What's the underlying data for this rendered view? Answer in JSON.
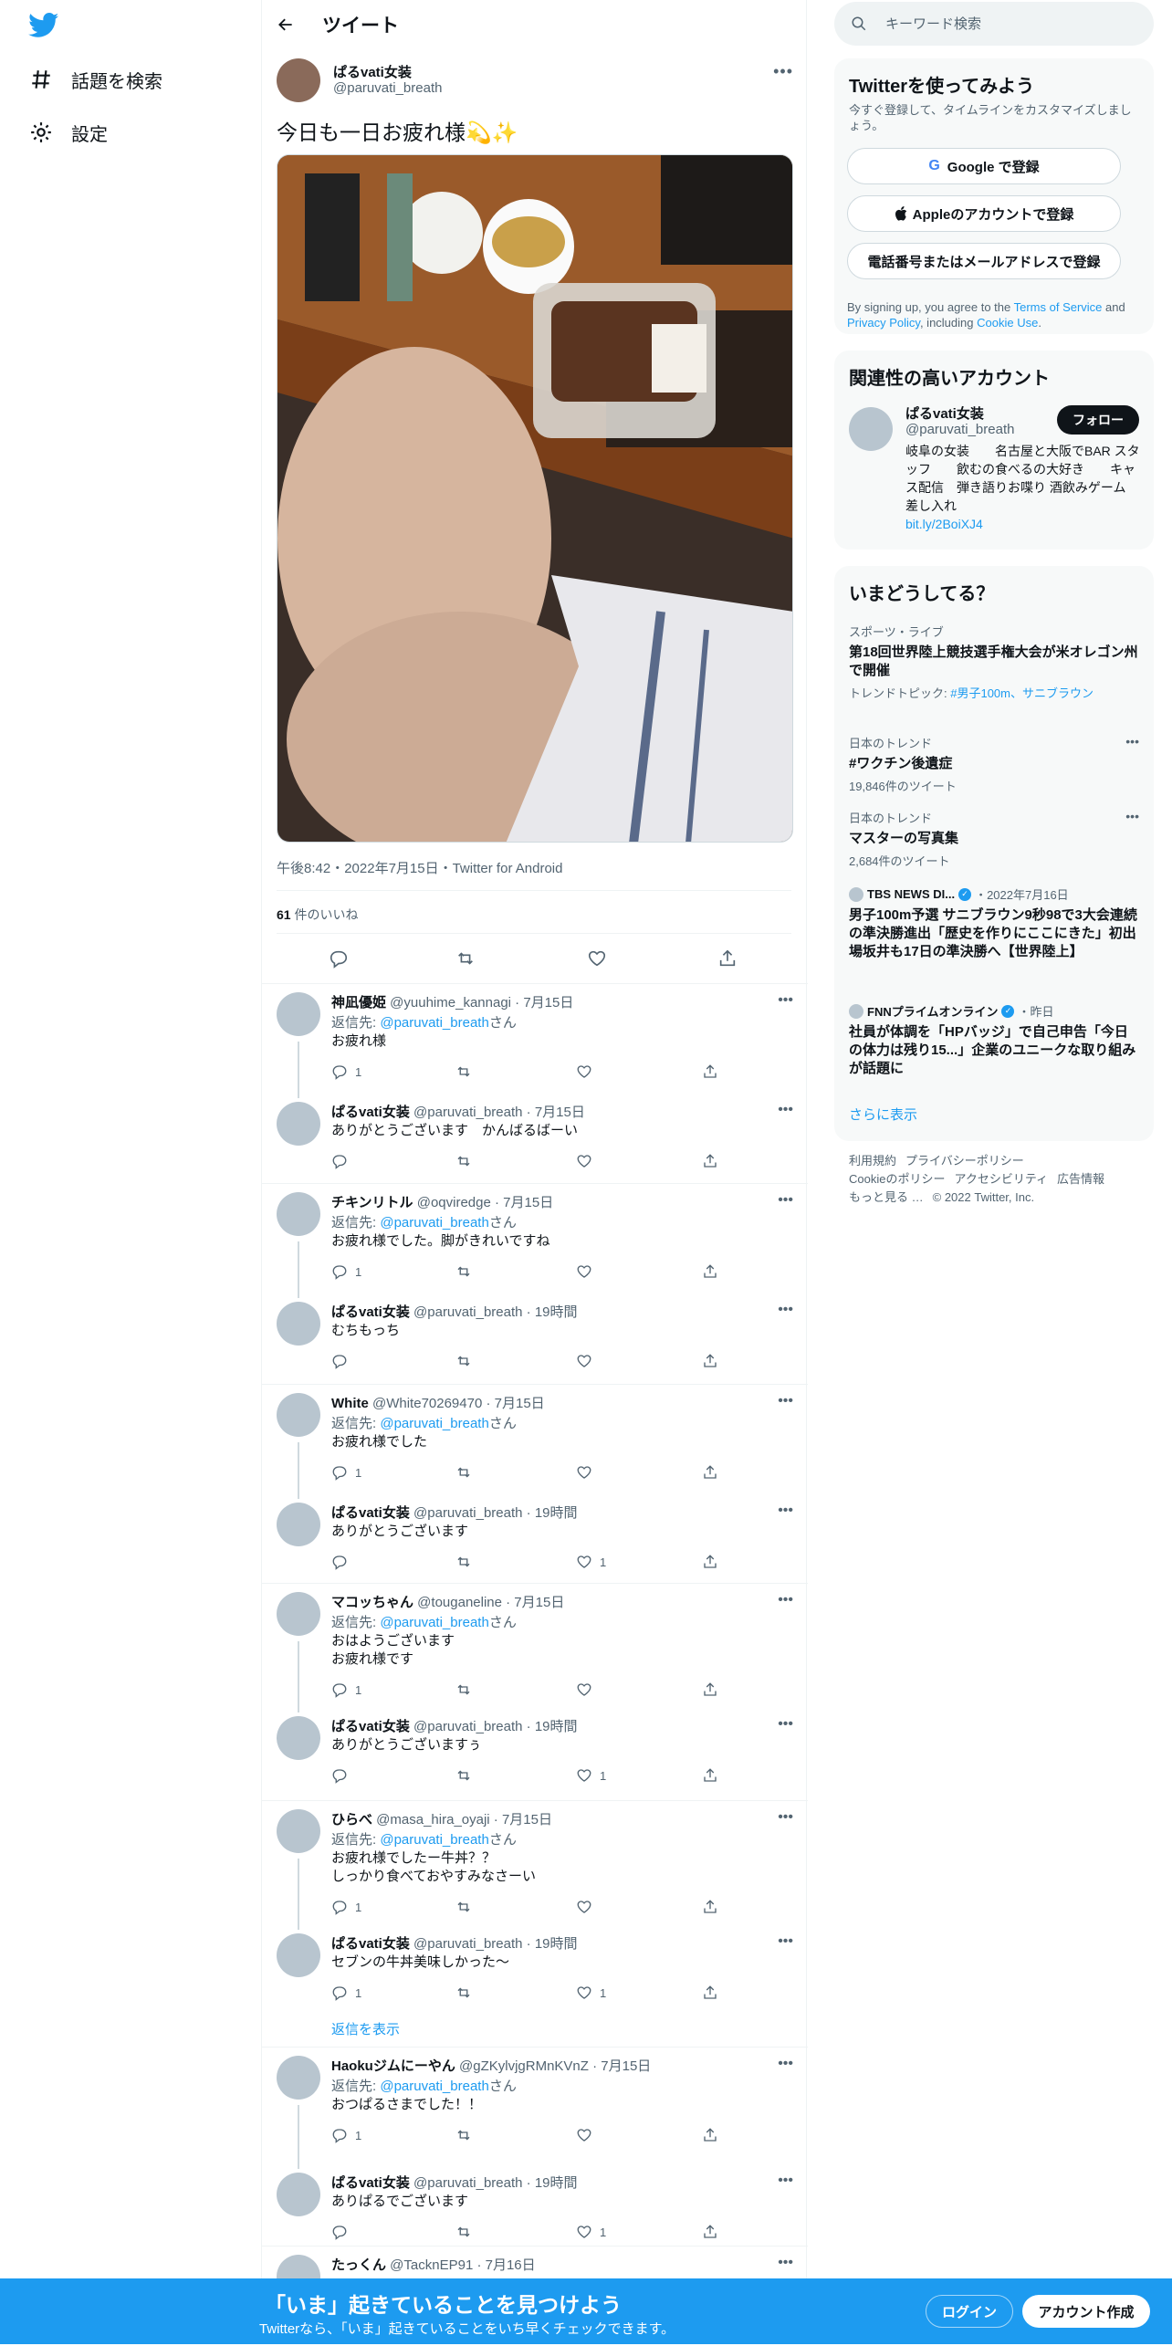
{
  "nav": {
    "explore": "話題を検索",
    "settings": "設定"
  },
  "header": {
    "title": "ツイート"
  },
  "tweet": {
    "name": "ぱるvati女装",
    "handle": "@paruvati_breath",
    "text": "今日も一日お疲れ様💫✨",
    "meta": "午後8:42・2022年7月15日・Twitter for Android",
    "likes_count": "61",
    "likes_label": "件のいいね"
  },
  "replies": [
    {
      "name": "神凪優姫",
      "handle": "@yuuhime_kannagi",
      "date": "7月15日",
      "reply_to": "@paruvati_breath",
      "body": "お疲れ様",
      "replies": "1",
      "retweets": "",
      "likes": ""
    },
    {
      "name": "ぱるvati女装",
      "handle": "@paruvati_breath",
      "date": "7月15日",
      "reply_to": "",
      "body": "ありがとうございます　かんばるばーい",
      "replies": "",
      "retweets": "",
      "likes": ""
    },
    {
      "name": "チキンリトル",
      "handle": "@oqviredge",
      "date": "7月15日",
      "reply_to": "@paruvati_breath",
      "body": "お疲れ様でした。脚がきれいですね",
      "replies": "1",
      "retweets": "",
      "likes": ""
    },
    {
      "name": "ぱるvati女装",
      "handle": "@paruvati_breath",
      "date": "19時間",
      "reply_to": "",
      "body": "むちもっち",
      "replies": "",
      "retweets": "",
      "likes": ""
    },
    {
      "name": "White",
      "handle": "@White70269470",
      "date": "7月15日",
      "reply_to": "@paruvati_breath",
      "body": "お疲れ様でした",
      "replies": "1",
      "retweets": "",
      "likes": ""
    },
    {
      "name": "ぱるvati女装",
      "handle": "@paruvati_breath",
      "date": "19時間",
      "reply_to": "",
      "body": "ありがとうございます",
      "replies": "",
      "retweets": "",
      "likes": "1"
    },
    {
      "name": "マコッちゃん",
      "handle": "@touganeline",
      "date": "7月15日",
      "reply_to": "@paruvati_breath",
      "body": "おはようございます\nお疲れ様です",
      "replies": "1",
      "retweets": "",
      "likes": ""
    },
    {
      "name": "ぱるvati女装",
      "handle": "@paruvati_breath",
      "date": "19時間",
      "reply_to": "",
      "body": "ありがとうございますぅ",
      "replies": "",
      "retweets": "",
      "likes": "1"
    },
    {
      "name": "ひらべ",
      "handle": "@masa_hira_oyaji",
      "date": "7月15日",
      "reply_to": "@paruvati_breath",
      "body": "お疲れ様でしたー牛丼？？\nしっかり食べておやすみなさーい",
      "replies": "1",
      "retweets": "",
      "likes": ""
    },
    {
      "name": "ぱるvati女装",
      "handle": "@paruvati_breath",
      "date": "19時間",
      "reply_to": "",
      "body": "セブンの牛丼美味しかった〜",
      "replies": "1",
      "retweets": "",
      "likes": "1"
    },
    {
      "name": "Haokuジムにーやん",
      "handle": "@gZKylvjgRMnKVnZ",
      "date": "7月15日",
      "reply_to": "@paruvati_breath",
      "body": "おつぱるさまでした！！",
      "replies": "1",
      "retweets": "",
      "likes": ""
    },
    {
      "name": "ぱるvati女装",
      "handle": "@paruvati_breath",
      "date": "19時間",
      "reply_to": "",
      "body": "ありぱるでございます",
      "replies": "",
      "retweets": "",
      "likes": "1"
    },
    {
      "name": "たっくん",
      "handle": "@TacknEP91",
      "date": "7月16日",
      "reply_to": "",
      "body": "",
      "replies": "",
      "retweets": "",
      "likes": ""
    }
  ],
  "reply_to_prefix": "返信先: ",
  "reply_to_suffix": "さん",
  "show_replies": "返信を表示",
  "search": {
    "placeholder": "キーワード検索"
  },
  "signup": {
    "title": "Twitterを使ってみよう",
    "subtitle": "今すぐ登録して、タイムラインをカスタマイズしましょう。",
    "google": "Google で登録",
    "apple": "Appleのアカウントで登録",
    "phone": "電話番号またはメールアドレスで登録",
    "terms_pre": "By signing up, you agree to the ",
    "terms_link": "Terms of Service",
    "terms_and": " and ",
    "privacy_link": "Privacy Policy",
    "terms_mid": ", including ",
    "cookie_link": "Cookie Use",
    "terms_end": "."
  },
  "related": {
    "title": "関連性の高いアカウント",
    "name": "ぱるvati女装",
    "handle": "@paruvati_breath",
    "follow": "フォロー",
    "bio": "岐阜の女装　　名古屋と大阪でBAR スタッフ　　飲むの食べるの大好き　　キャス配信　弾き語りお喋り 酒飲みゲーム　差し入れ",
    "bio_link": "bit.ly/2BoiXJ4"
  },
  "trends": {
    "title": "いまどうしてる？",
    "items": [
      {
        "context": "スポーツ・ライブ",
        "title": "第18回世界陸上競技選手権大会が米オレゴン州で開催",
        "note_pre": "トレンドトピック: ",
        "note_link": "#男子100m、サニブラウン"
      },
      {
        "context": "日本のトレンド",
        "title": "#ワクチン後遺症",
        "note": "19,846件のツイート"
      },
      {
        "context": "日本のトレンド",
        "title": "マスターの写真集",
        "note": "2,684件のツイート"
      }
    ],
    "news": [
      {
        "source": "TBS NEWS DI...",
        "date": "・2022年7月16日",
        "title": "男子100m予選 サニブラウン9秒98で3大会連続の準決勝進出「歴史を作りにここにきた」初出場坂井も17日の準決勝へ【世界陸上】"
      },
      {
        "source": "FNNプライムオンライン",
        "date": "・昨日",
        "title": "社員が体調を「HPバッジ」で自己申告「今日の体力は残り15...」企業のユニークな取り組みが話題に"
      }
    ],
    "more": "さらに表示"
  },
  "footer": {
    "line1": [
      "利用規約",
      "プライバシーポリシー"
    ],
    "line2": [
      "Cookieのポリシー",
      "アクセシビリティ",
      "広告情報"
    ],
    "line3": [
      "もっと見る …",
      "© 2022 Twitter, Inc."
    ]
  },
  "bottom": {
    "headline": "「いま」起きていることを見つけよう",
    "sub": "Twitterなら、「いま」起きていることをいち早くチェックできます。",
    "login": "ログイン",
    "signup": "アカウント作成"
  },
  "colors": {
    "accent": "#1d9bf0",
    "text": "#0f1419",
    "muted": "#536471"
  }
}
